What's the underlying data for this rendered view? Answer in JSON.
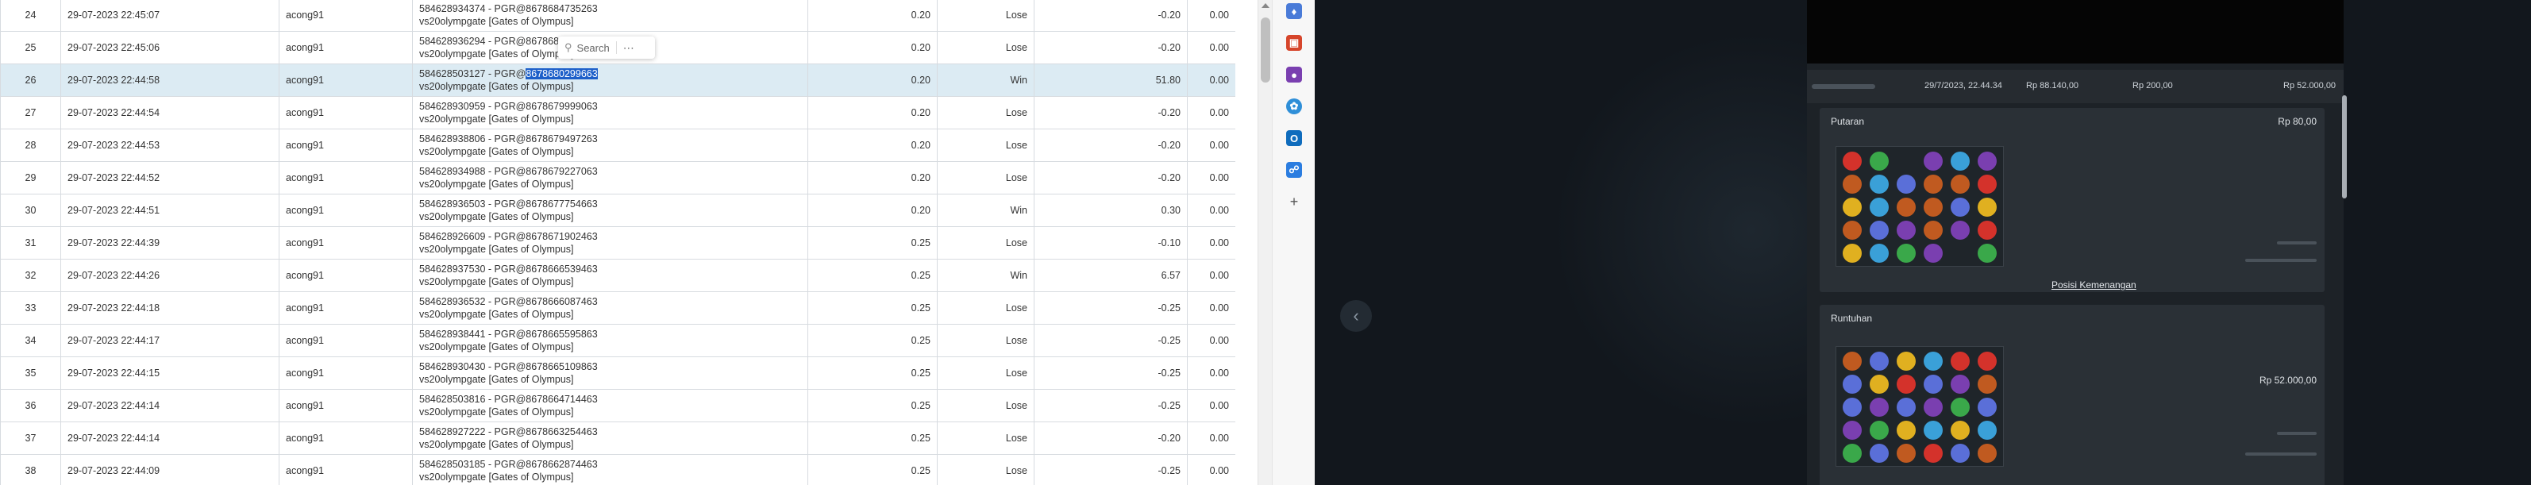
{
  "table": {
    "rows": [
      {
        "no": "24",
        "date": "29-07-2023 22:45:07",
        "user": "acong91",
        "round_id": "584628934374 - PGR@8678684735263",
        "game": "vs20olympgate [Gates of Olympus]",
        "bet": "0.20",
        "result": "Lose",
        "winlose": "-0.20",
        "jackpot": "0.00"
      },
      {
        "no": "25",
        "date": "29-07-2023 22:45:06",
        "user": "acong91",
        "round_id": "584628936294 - PGR@86786840",
        "game": "vs20olympgate [Gates of Olympus]",
        "bet": "0.20",
        "result": "Lose",
        "winlose": "-0.20",
        "jackpot": "0.00"
      },
      {
        "no": "26",
        "date": "29-07-2023 22:44:58",
        "user": "acong91",
        "round_id_prefix": "584628503127 - PGR@",
        "round_id_highlight": "8678680299663",
        "game": "vs20olympgate [Gates of Olympus]",
        "bet": "0.20",
        "result": "Win",
        "winlose": "51.80",
        "jackpot": "0.00",
        "selected": true
      },
      {
        "no": "27",
        "date": "29-07-2023 22:44:54",
        "user": "acong91",
        "round_id": "584628930959 - PGR@8678679999063",
        "game": "vs20olympgate [Gates of Olympus]",
        "bet": "0.20",
        "result": "Lose",
        "winlose": "-0.20",
        "jackpot": "0.00"
      },
      {
        "no": "28",
        "date": "29-07-2023 22:44:53",
        "user": "acong91",
        "round_id": "584628938806 - PGR@8678679497263",
        "game": "vs20olympgate [Gates of Olympus]",
        "bet": "0.20",
        "result": "Lose",
        "winlose": "-0.20",
        "jackpot": "0.00"
      },
      {
        "no": "29",
        "date": "29-07-2023 22:44:52",
        "user": "acong91",
        "round_id": "584628934988 - PGR@8678679227063",
        "game": "vs20olympgate [Gates of Olympus]",
        "bet": "0.20",
        "result": "Lose",
        "winlose": "-0.20",
        "jackpot": "0.00"
      },
      {
        "no": "30",
        "date": "29-07-2023 22:44:51",
        "user": "acong91",
        "round_id": "584628936503 - PGR@8678677754663",
        "game": "vs20olympgate [Gates of Olympus]",
        "bet": "0.20",
        "result": "Win",
        "winlose": "0.30",
        "jackpot": "0.00"
      },
      {
        "no": "31",
        "date": "29-07-2023 22:44:39",
        "user": "acong91",
        "round_id": "584628926609 - PGR@8678671902463",
        "game": "vs20olympgate [Gates of Olympus]",
        "bet": "0.25",
        "result": "Lose",
        "winlose": "-0.10",
        "jackpot": "0.00"
      },
      {
        "no": "32",
        "date": "29-07-2023 22:44:26",
        "user": "acong91",
        "round_id": "584628937530 - PGR@8678666539463",
        "game": "vs20olympgate [Gates of Olympus]",
        "bet": "0.25",
        "result": "Win",
        "winlose": "6.57",
        "jackpot": "0.00"
      },
      {
        "no": "33",
        "date": "29-07-2023 22:44:18",
        "user": "acong91",
        "round_id": "584628936532 - PGR@8678666087463",
        "game": "vs20olympgate [Gates of Olympus]",
        "bet": "0.25",
        "result": "Lose",
        "winlose": "-0.25",
        "jackpot": "0.00"
      },
      {
        "no": "34",
        "date": "29-07-2023 22:44:17",
        "user": "acong91",
        "round_id": "584628938441 - PGR@8678665595863",
        "game": "vs20olympgate [Gates of Olympus]",
        "bet": "0.25",
        "result": "Lose",
        "winlose": "-0.25",
        "jackpot": "0.00"
      },
      {
        "no": "35",
        "date": "29-07-2023 22:44:15",
        "user": "acong91",
        "round_id": "584628930430 - PGR@8678665109863",
        "game": "vs20olympgate [Gates of Olympus]",
        "bet": "0.25",
        "result": "Lose",
        "winlose": "-0.25",
        "jackpot": "0.00"
      },
      {
        "no": "36",
        "date": "29-07-2023 22:44:14",
        "user": "acong91",
        "round_id": "584628503816 - PGR@8678664714463",
        "game": "vs20olympgate [Gates of Olympus]",
        "bet": "0.25",
        "result": "Lose",
        "winlose": "-0.25",
        "jackpot": "0.00"
      },
      {
        "no": "37",
        "date": "29-07-2023 22:44:14",
        "user": "acong91",
        "round_id": "584628927222 - PGR@8678663254463",
        "game": "vs20olympgate [Gates of Olympus]",
        "bet": "0.25",
        "result": "Lose",
        "winlose": "-0.20",
        "jackpot": "0.00"
      },
      {
        "no": "38",
        "date": "29-07-2023 22:44:09",
        "user": "acong91",
        "round_id": "584628503185 - PGR@8678662874463",
        "game": "vs20olympgate [Gates of Olympus]",
        "bet": "0.25",
        "result": "Lose",
        "winlose": "-0.25",
        "jackpot": "0.00"
      }
    ]
  },
  "search_popup": {
    "label": "Search",
    "more": "⋯"
  },
  "colors": {
    "lose": "#e1181e",
    "win": "#1f9a34",
    "selected_row": "#dcebf3",
    "highlight": "#1d5fc9"
  },
  "sidebar_icons": [
    "tag-icon",
    "toolbox-icon",
    "people-icon",
    "copilot-icon",
    "outlook-icon",
    "shopping-icon",
    "add-icon"
  ],
  "game": {
    "history": {
      "date": "29/7/2023, 22.44.34",
      "balance": "Rp 88.140,00",
      "bet": "Rp 200,00",
      "win": "Rp 52.000,00"
    },
    "putaran": {
      "title": "Putaran",
      "amount": "Rp 80,00",
      "link": "Posisi Kemenangan"
    },
    "runtuhan": {
      "title": "Runtuhan",
      "amount": "Rp 52.000,00"
    }
  }
}
